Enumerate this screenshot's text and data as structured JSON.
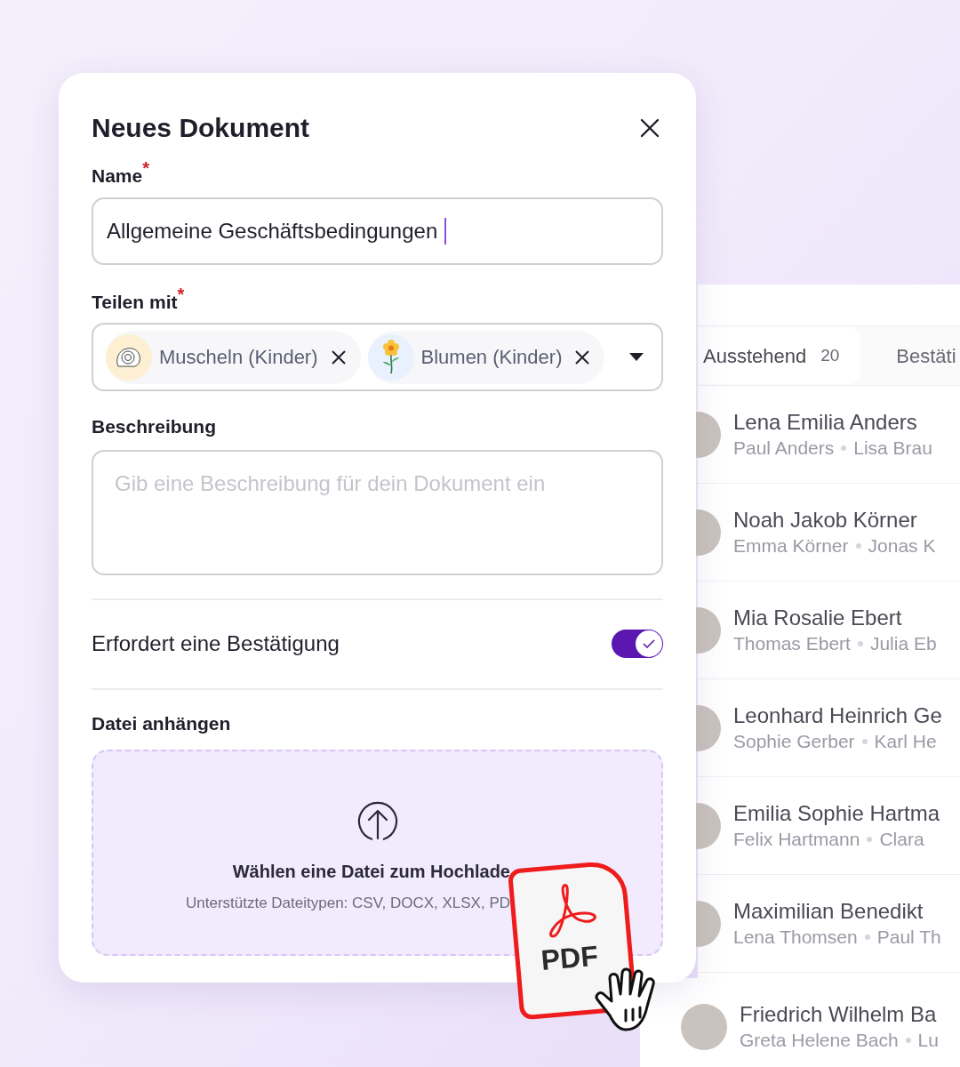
{
  "dialog": {
    "title": "Neues Dokument",
    "name_field": {
      "label": "Name",
      "required_mark": "*",
      "value": "Allgemeine Geschäftsbedingungen",
      "focused": true
    },
    "share_field": {
      "label": "Teilen mit",
      "required_mark": "*",
      "chips": [
        {
          "label": "Muscheln (Kinder)",
          "kind": "shell",
          "color": "#fdf0d2"
        },
        {
          "label": "Blumen (Kinder)",
          "kind": "flower",
          "color": "#e8f1fd"
        }
      ]
    },
    "description_field": {
      "label": "Beschreibung",
      "placeholder": "Gib eine Beschreibung für dein Dokument ein"
    },
    "confirmation_toggle": {
      "label": "Erfordert eine Bestätigung",
      "on": true
    },
    "attachment": {
      "label": "Datei anhängen",
      "title": "Wählen eine Datei zum Hochlade",
      "hint": "Unterstützte Dateitypen: CSV, DOCX, XLSX, PD"
    },
    "dragged_file": {
      "label": "PDF"
    }
  },
  "list_panel": {
    "tabs": [
      {
        "label": "Ausstehend",
        "count": "20",
        "selected": true
      },
      {
        "label": "Bestäti",
        "selected": false
      }
    ],
    "rows": [
      {
        "name": "Lena Emilia Anders",
        "parents": [
          "Paul Anders",
          "Lisa Brau"
        ]
      },
      {
        "name": "Noah Jakob Körner",
        "parents": [
          "Emma Körner",
          "Jonas K"
        ]
      },
      {
        "name": "Mia Rosalie Ebert",
        "parents": [
          "Thomas Ebert",
          "Julia Eb"
        ]
      },
      {
        "name": "Leonhard Heinrich Ge",
        "parents": [
          "Sophie Gerber",
          "Karl He"
        ]
      },
      {
        "name": "Emilia Sophie Hartma",
        "parents": [
          "Felix Hartmann",
          "Clara"
        ]
      },
      {
        "name": "Maximilian Benedikt",
        "parents": [
          "Lena Thomsen",
          "Paul Th"
        ]
      },
      {
        "name": "Friedrich Wilhelm Ba",
        "parents": [
          "Greta Helene Bach",
          "Lu"
        ]
      }
    ]
  }
}
